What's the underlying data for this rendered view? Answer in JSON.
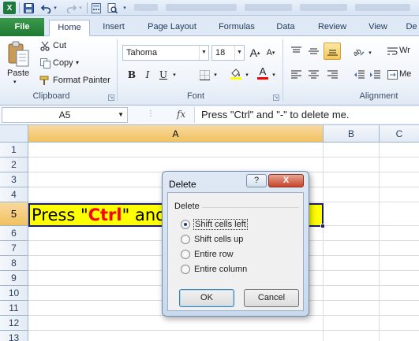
{
  "titlebar": {
    "logo_text": "X"
  },
  "tabs": [
    "File",
    "Home",
    "Insert",
    "Page Layout",
    "Formulas",
    "Data",
    "Review",
    "View",
    "De"
  ],
  "ribbon": {
    "clipboard": {
      "paste_label": "Paste",
      "cut_label": "Cut",
      "copy_label": "Copy",
      "copy_arrow": "▾",
      "format_painter_label": "Format Painter",
      "group_label": "Clipboard"
    },
    "font": {
      "font_name": "Tahoma",
      "font_size": "18",
      "grow_label": "A",
      "shrink_label": "A",
      "bold": "B",
      "italic": "I",
      "underline": "U",
      "font_color_label": "A",
      "fill_color": "#ffff00",
      "font_color": "#ff0000",
      "group_label": "Font"
    },
    "alignment": {
      "wrap_label": "Wr",
      "merge_label": "Me",
      "group_label": "Alignment"
    }
  },
  "formula_bar": {
    "name_box": "A5",
    "fx_label": "fx",
    "formula": "Press \"Ctrl\" and \"-\" to delete me."
  },
  "grid": {
    "columns": [
      "A",
      "B",
      "C"
    ],
    "selected_column": "A",
    "rows": [
      "1",
      "2",
      "3",
      "4",
      "5",
      "6",
      "7",
      "8",
      "9",
      "10",
      "11",
      "12",
      "13"
    ],
    "selected_row": "5",
    "cell_a5": {
      "part1": "Press \"",
      "ctrl": "Ctrl",
      "part2": "\" and \"-\" to delete me.",
      "fill": "#ffff00",
      "ctrl_color": "#ff0000"
    }
  },
  "dialog": {
    "title": "Delete",
    "help_button": "?",
    "close_button": "X",
    "group_label": "Delete",
    "options": [
      {
        "label": "Shift cells left",
        "selected": true
      },
      {
        "label": "Shift cells up",
        "selected": false
      },
      {
        "label": "Entire row",
        "selected": false
      },
      {
        "label": "Entire column",
        "selected": false
      }
    ],
    "ok_label": "OK",
    "cancel_label": "Cancel"
  }
}
